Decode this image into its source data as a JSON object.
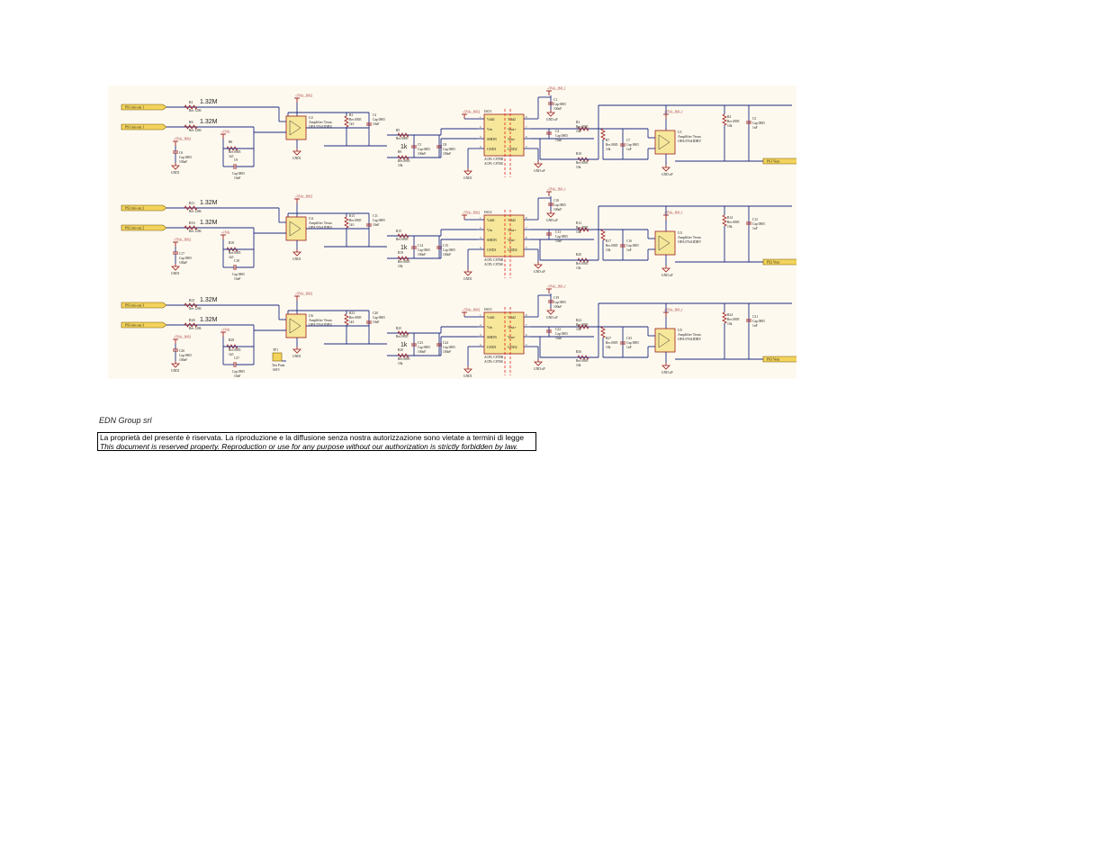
{
  "document": {
    "company": "EDN Group srl",
    "disclaimer_it": "La proprietà del presente è riservata. La riproduzione e la diffusione senza nostra autorizzazione sono vietate a termini di legge",
    "disclaimer_en": "This document is reserved property. Reproduction or use for any purpose without our authorization is strictly forbidden by law."
  },
  "schematic": {
    "colors": {
      "wire": "#1f2a80",
      "sheet": "#fdf9ef",
      "component": "#9b1c1c",
      "ic_fill": "#f7e79a",
      "port_fill": "#f2d35c",
      "isolation": "#e02020"
    },
    "channels": [
      {
        "id": "ch1",
        "in_p_port": "PS1 mis out 1",
        "in_n_port": "PS1 mis out 1",
        "r_in_p": "R1",
        "r_in_n": "R6",
        "r_in_value": "1.32M",
        "r_in_pkg": "Res 1206",
        "r_small_fb": "R8",
        "r_small_fb_val": "1k5",
        "c_in": "C6",
        "c_in_val": "100nF",
        "c_fb": "C9",
        "c_fb_val": "10nF",
        "amp1": "U2",
        "amp_desc": "Amplifier Texas",
        "amp_part": "OPA376AIDBV",
        "r_div": "R3",
        "r_div_val": "1k5",
        "c_out": "C2",
        "c_out_val": "10nF",
        "r_filter_a": "R5",
        "r_filter_b": "R9",
        "r_filter_val": "1k",
        "r_filter_b_val": "10k",
        "c_a": "C5",
        "c_b": "C8",
        "c_ab_val": "100nF",
        "iso": "ISO1",
        "iso_pins_left": [
          "Vdd1",
          "Vin",
          "SHDN",
          "GND1"
        ],
        "iso_pins_right": [
          "Vdd2",
          "Vout+",
          "Vout-",
          "GND2"
        ],
        "iso_part": "ACPL-C87",
        "c_iso": "C1",
        "c_iso_val": "100nF",
        "c_iso2": "C4",
        "c_iso2_val": "10nF",
        "r_iso_a": "R2",
        "r_iso_b": "R10",
        "r_iso_val": "10k",
        "r_out_a": "R7",
        "c_out_b": "C7",
        "c_out_b_val": "1nF",
        "amp2": "U1",
        "r_fb2": "R4",
        "r_fb2_val": "10k",
        "c_fb2": "C3",
        "c_fb2_val": "1nF",
        "out_port": "PS1 Vout",
        "supply_iso": "+5Vdc_ISO2",
        "supply_f": "+5Vdc_ISO_f",
        "supply_1v": "+1Vdc",
        "gnd_a": "GND1",
        "gnd_b": "GND uP"
      },
      {
        "id": "ch2",
        "in_p_port": "PS2 mis out 2",
        "in_n_port": "PS2 mis out 2",
        "r_in_p": "R11",
        "r_in_n": "R16",
        "r_in_value": "1.32M",
        "r_in_pkg": "Res 1206",
        "r_small_fb": "R18",
        "r_small_fb_val": "1k5",
        "c_in": "C17",
        "c_in_val": "100nF",
        "c_fb": "C18",
        "c_fb_val": "10nF",
        "amp1": "U4",
        "amp_desc": "Amplifier Texas",
        "amp_part": "OPA376AIDBV",
        "r_div": "R13",
        "r_div_val": "1k5",
        "c_out": "C11",
        "c_out_val": "10nF",
        "r_filter_a": "R15",
        "r_filter_b": "R19",
        "r_filter_val": "1k",
        "r_filter_b_val": "10k",
        "c_a": "C14",
        "c_b": "C15",
        "c_ab_val": "100nF",
        "iso": "ISO2",
        "iso_pins_left": [
          "Vdd1",
          "Vin",
          "SHDN",
          "GND1"
        ],
        "iso_pins_right": [
          "Vdd2",
          "Vout+",
          "Vout-",
          "GND2"
        ],
        "iso_part": "ACPL-C87",
        "c_iso": "C10",
        "c_iso_val": "100nF",
        "c_iso2": "C13",
        "c_iso2_val": "10nF",
        "r_iso_a": "R12",
        "r_iso_b": "R20",
        "r_iso_val": "10k",
        "r_out_a": "R17",
        "c_out_b": "C16",
        "c_out_b_val": "1nF",
        "amp2": "U3",
        "r_fb2": "R14",
        "r_fb2_val": "10k",
        "c_fb2": "C12",
        "c_fb2_val": "1nF",
        "out_port": "PS2 Vout",
        "supply_iso": "+5Vdc_ISO2",
        "supply_f": "+5Vdc_ISO_f",
        "supply_1v": "+1Vdc",
        "gnd_a": "GND1",
        "gnd_b": "GND uP"
      },
      {
        "id": "ch3",
        "in_p_port": "PS3 mis out 3",
        "in_n_port": "PS3 mis out 3",
        "r_in_p": "R21",
        "r_in_n": "R26",
        "r_in_value": "1.32M",
        "r_in_pkg": "Res 1206",
        "r_small_fb": "R28",
        "r_small_fb_val": "1k5",
        "c_in": "C26",
        "c_in_val": "100nF",
        "c_fb": "C27",
        "c_fb_val": "10nF",
        "amp1": "U6",
        "amp_desc": "Amplifier Texas",
        "amp_part": "OPA376AIDBV",
        "r_div": "R23",
        "r_div_val": "1k5",
        "c_out": "C20",
        "c_out_val": "10nF",
        "r_filter_a": "R25",
        "r_filter_b": "R29",
        "r_filter_val": "1k",
        "r_filter_b_val": "10k",
        "c_a": "C23",
        "c_b": "C24",
        "c_ab_val": "100nF",
        "iso": "ISO3",
        "iso_pins_left": [
          "Vdd1",
          "Vin",
          "SHDN",
          "GND1"
        ],
        "iso_pins_right": [
          "Vdd2",
          "Vout+",
          "Vout-",
          "GND2"
        ],
        "iso_part": "ACPL-C87",
        "c_iso": "C19",
        "c_iso_val": "100nF",
        "c_iso2": "C22",
        "c_iso2_val": "10nF",
        "r_iso_a": "R22",
        "r_iso_b": "R30",
        "r_iso_val": "10k",
        "r_out_a": "R27",
        "c_out_b": "C25",
        "c_out_b_val": "1nF",
        "amp2": "U5",
        "r_fb2": "R24",
        "r_fb2_val": "10k",
        "c_fb2": "C21",
        "c_fb2_val": "1nF",
        "out_port": "PS3 Vout",
        "supply_iso": "+5Vdc_ISO2",
        "supply_f": "+5Vdc_ISO_f",
        "supply_1v": "+1Vdc",
        "gnd_a": "GND1",
        "gnd_b": "GND uP"
      }
    ],
    "test_point": {
      "ref": "TP1",
      "label": "Test Point",
      "pkg": "S019"
    },
    "pkg_res_0805": "Res 0805",
    "pkg_cap_0805": "Cap 0805"
  }
}
